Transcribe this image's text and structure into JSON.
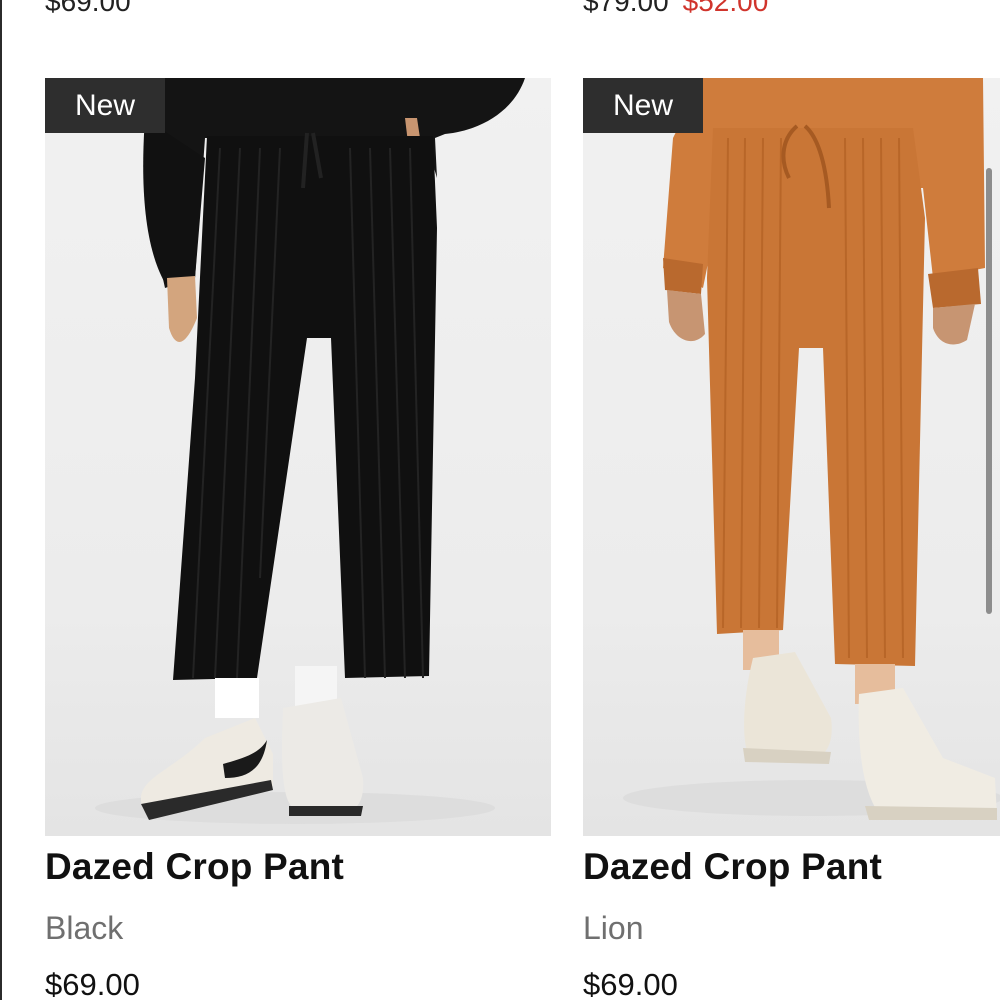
{
  "previous_row": {
    "left_price": "$69.00",
    "right_price": "$79.00",
    "right_sale_price": "$52.00"
  },
  "products": [
    {
      "badge": "New",
      "name": "Dazed Crop Pant",
      "color": "Black",
      "price": "$69.00",
      "garment_color": "#111111"
    },
    {
      "badge": "New",
      "name": "Dazed Crop Pant",
      "color": "Lion",
      "price": "$69.00",
      "garment_color": "#c97636"
    }
  ],
  "colors": {
    "badge_bg": "#2e2e2e",
    "sale_red": "#d0342c",
    "variant_gray": "#6f6f6f"
  }
}
